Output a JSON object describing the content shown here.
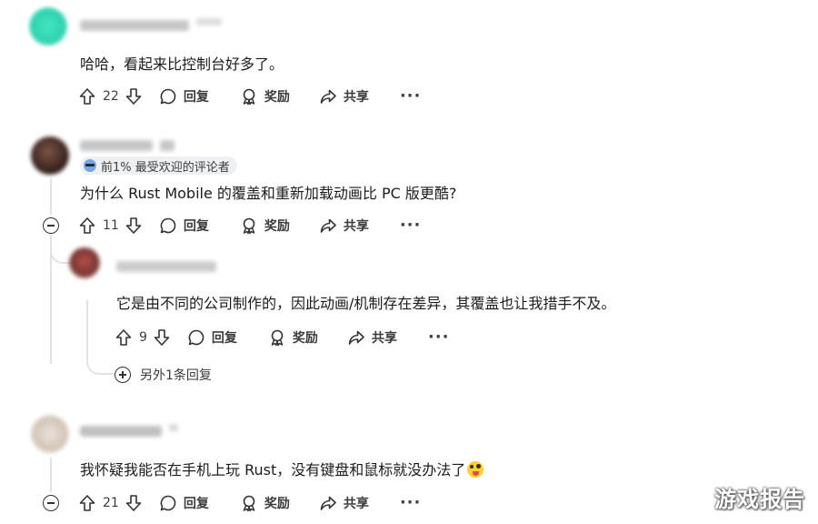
{
  "comments": [
    {
      "text": "哈哈，看起来比控制台好多了。",
      "votes": "22",
      "reply_label": "回复",
      "award_label": "奖励",
      "share_label": "共享",
      "more_label": "···"
    },
    {
      "badge": "前1% 最受欢迎的评论者",
      "text": "为什么 Rust Mobile 的覆盖和重新加载动画比 PC 版更酷?",
      "votes": "11",
      "reply_label": "回复",
      "award_label": "奖励",
      "share_label": "共享",
      "more_label": "···",
      "reply": {
        "text": "它是由不同的公司制作的，因此动画/机制存在差异，其覆盖也让我措手不及。",
        "votes": "9",
        "reply_label": "回复",
        "award_label": "奖励",
        "share_label": "共享",
        "more_label": "···"
      },
      "more_replies": "另外1条回复"
    },
    {
      "text": "我怀疑我能否在手机上玩 Rust，没有键盘和鼠标就没办法了",
      "votes": "21",
      "reply_label": "回复",
      "award_label": "奖励",
      "share_label": "共享",
      "more_label": "···"
    }
  ],
  "watermark": "游戏报告",
  "colors": {
    "text": "#1c1c1c",
    "muted": "#3c3c3c",
    "thread_line": "#e2e2e2",
    "badge_bg": "#eef0f2"
  }
}
